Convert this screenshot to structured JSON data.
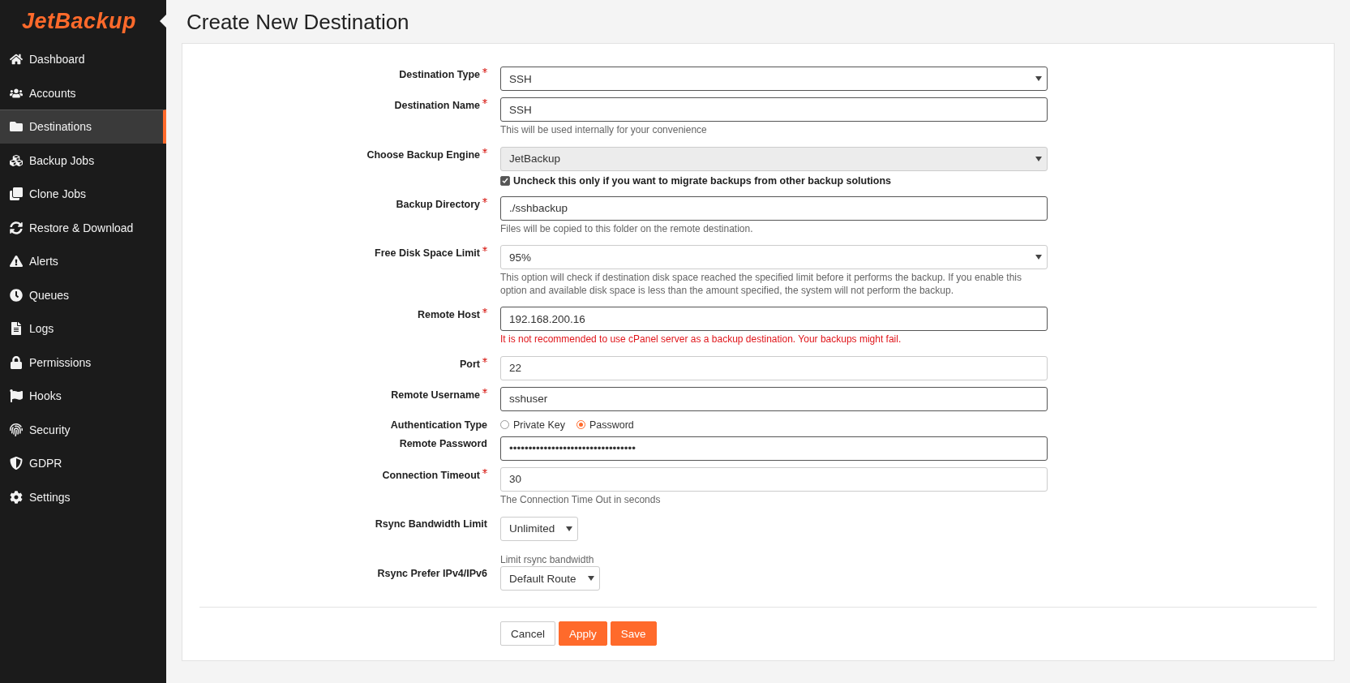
{
  "sidebar": {
    "logo": "JetBackup",
    "items": [
      {
        "label": "Dashboard",
        "selected": false
      },
      {
        "label": "Accounts",
        "selected": false
      },
      {
        "label": "Destinations",
        "selected": true
      },
      {
        "label": "Backup Jobs",
        "selected": false
      },
      {
        "label": "Clone Jobs",
        "selected": false
      },
      {
        "label": "Restore & Download",
        "selected": false
      },
      {
        "label": "Alerts",
        "selected": false
      },
      {
        "label": "Queues",
        "selected": false
      },
      {
        "label": "Logs",
        "selected": false
      },
      {
        "label": "Permissions",
        "selected": false
      },
      {
        "label": "Hooks",
        "selected": false
      },
      {
        "label": "Security",
        "selected": false
      },
      {
        "label": "GDPR",
        "selected": false
      },
      {
        "label": "Settings",
        "selected": false
      }
    ]
  },
  "page": {
    "title": "Create New Destination"
  },
  "form": {
    "fields": [
      {
        "kind": "select",
        "label": "Destination Type",
        "required": true,
        "value": "SSH"
      },
      {
        "kind": "text",
        "label": "Destination Name",
        "required": true,
        "value": "SSH",
        "hint": "This will be used internally for your convenience"
      },
      {
        "kind": "select",
        "label": "Choose Backup Engine",
        "required": true,
        "value": "JetBackup",
        "disabled": true,
        "checkbox": {
          "label": "Uncheck this only if you want to migrate backups from other backup solutions",
          "checked": true
        }
      },
      {
        "kind": "text",
        "label": "Backup Directory",
        "required": true,
        "value": "./sshbackup",
        "hint": "Files will be copied to this folder on the remote destination."
      },
      {
        "kind": "select",
        "label": "Free Disk Space Limit",
        "required": true,
        "value": "95%",
        "hint": "This option will check if destination disk space reached the specified limit before it performs the backup. If you enable this option and available disk space is less than the amount specified, the system will not perform the backup."
      },
      {
        "kind": "text",
        "label": "Remote Host",
        "required": true,
        "value": "192.168.200.16",
        "error": "It is not recommended to use cPanel server as a backup destination. Your backups might fail."
      },
      {
        "kind": "text",
        "label": "Port",
        "required": true,
        "value": "22"
      },
      {
        "kind": "text",
        "label": "Remote Username",
        "required": true,
        "value": "sshuser"
      },
      {
        "kind": "radio",
        "label": "Authentication Type",
        "required": false,
        "options": [
          {
            "label": "Private Key",
            "selected": false
          },
          {
            "label": "Password",
            "selected": true
          }
        ]
      },
      {
        "kind": "text",
        "label": "Remote Password",
        "required": false,
        "value": "•••••••••••••••••••••••••••••••••"
      },
      {
        "kind": "text",
        "label": "Connection Timeout",
        "required": true,
        "value": "30",
        "hint": "The Connection Time Out in seconds"
      },
      {
        "kind": "compact-select",
        "label": "Rsync Bandwidth Limit",
        "required": false,
        "value": "Unlimited",
        "hint": "Limit rsync bandwidth"
      },
      {
        "kind": "compact-select",
        "label": "Rsync Prefer IPv4/IPv6",
        "required": false,
        "value": "Default Route"
      }
    ],
    "buttons": [
      {
        "label": "Cancel",
        "kind": "default"
      },
      {
        "label": "Apply",
        "kind": "primary"
      },
      {
        "label": "Save",
        "kind": "primary"
      }
    ]
  }
}
